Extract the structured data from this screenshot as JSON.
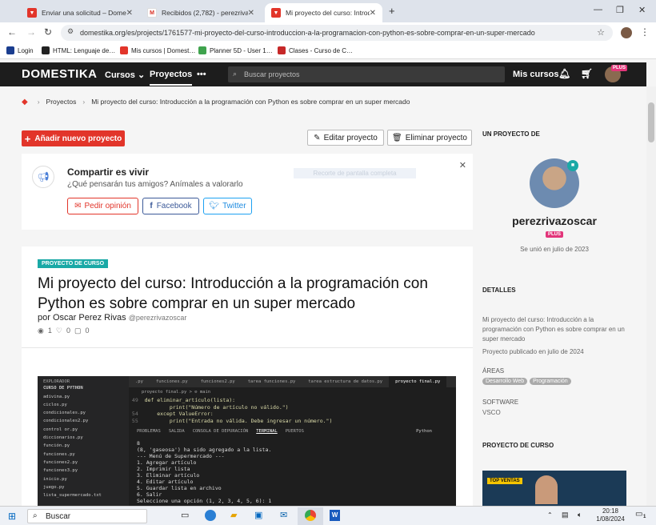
{
  "browser": {
    "tabs": [
      {
        "label": "Enviar una solicitud – Domestika",
        "fav_color": "#e2352a",
        "fav": "M"
      },
      {
        "label": "Recibidos (2,782) - perezrivazo…",
        "fav_color": "#ffffff",
        "fav": "M"
      },
      {
        "label": "Mi proyecto del curso: Introduc…",
        "fav_color": "#e2352a",
        "fav": "M"
      }
    ],
    "new_tab": "+",
    "url": "domestika.org/es/projects/1761577-mi-proyecto-del-curso-introduccion-a-la-programacion-con-python-es-sobre-comprar-en-un-super-mercado",
    "bookmarks": [
      {
        "label": "Login",
        "color": "#1a3d8f"
      },
      {
        "label": "HTML: Lenguaje de…",
        "color": "#222222"
      },
      {
        "label": "Mis cursos | Domest…",
        "color": "#e2352a"
      },
      {
        "label": "Planner 5D - User 1…",
        "color": "#3fa34d"
      },
      {
        "label": "Clases - Curso de C…",
        "color": "#c62828"
      }
    ]
  },
  "site": {
    "logo": "DOMESTIKA",
    "nav": {
      "cursos": "Cursos",
      "proyectos": "Proyectos",
      "more": "•••",
      "mis_cursos": "Mis cursos"
    },
    "search_placeholder": "Buscar proyectos",
    "plus_badge": "PLUS"
  },
  "breadcrumb": {
    "item1": "Proyectos",
    "item2": "Mi proyecto del curso: Introducción a la programación con Python es sobre comprar en un super mercado"
  },
  "actions": {
    "add_project": "Añadir nuevo proyecto",
    "edit": "Editar proyecto",
    "delete": "Eliminar proyecto"
  },
  "share": {
    "title": "Compartir es vivir",
    "subtitle": "¿Qué pensarán tus amigos? Anímales a valorarlo",
    "overlay": "Recorte de pantalla completa",
    "ask": "Pedir opinión",
    "facebook": "Facebook",
    "twitter": "Twitter"
  },
  "project": {
    "badge": "PROYECTO DE CURSO",
    "title_line1": "Mi proyecto del curso: Introducción a la programación con",
    "title_line2": "Python es sobre comprar en un super mercado",
    "author_prefix": "por",
    "author": "Oscar Perez Rivas",
    "handle": "@perezrivazoscar",
    "views": "1",
    "likes": "0",
    "comments": "0"
  },
  "code_screenshot": {
    "explorer_title": "EXPLORADOR",
    "folder": "CURSO DE PYTHON",
    "files": [
      "adivina.py",
      "ciclos.py",
      "condicionales.py",
      "condicionales2.py",
      "control or.py",
      "diccionarios.py",
      "función.py",
      "funciones.py",
      "funciones2.py",
      "funciones3.py",
      "inicio.py",
      "juego.py",
      "lista_supermercado.txt"
    ],
    "tabs": [
      ".py",
      "funciones.py",
      "funciones2.py",
      "tarea funciones.py",
      "tarea estructura de datos.py",
      "proyecto final.py"
    ],
    "breadcrumb": "proyecto final.py > ⊙ main",
    "code_lines": [
      {
        "n": "49",
        "t": "def eliminar_artículo(lista):"
      },
      {
        "n": "",
        "t": "        print(\"Número de artículo no válido.\")"
      },
      {
        "n": "54",
        "t": "    except ValueError:"
      },
      {
        "n": "55",
        "t": "        print(\"Entrada no válida. Debe ingresar un número.\")"
      }
    ],
    "panel_tabs": [
      "PROBLEMAS",
      "SALIDA",
      "CONSOLA DE DEPURACIÓN",
      "TERMINAL",
      "PUERTOS"
    ],
    "panel_right": "Python",
    "terminal": [
      "8",
      "(8, 'gaseosa') ha sido agregado a la lista.",
      "--- Menú de Supermercado ---",
      "1. Agregar artículo",
      "2. Imprimir lista",
      "3. Eliminar artículo",
      "4. Editar artículo",
      "5. Guardar lista en archivo",
      "6. Salir",
      "Seleccione una opción (1, 2, 3, 4, 5, 6): 1"
    ]
  },
  "sidebar": {
    "section_project_of": "UN PROYECTO DE",
    "username": "perezrivazoscar",
    "plus": "PLUS",
    "joined": "Se unió en julio de 2023",
    "details_title": "DETALLES",
    "details_text": "Mi proyecto del curso: Introducción a la programación con Python es sobre comprar en un super mercado",
    "published": "Proyecto publicado en julio de 2024",
    "areas_title": "ÁREAS",
    "areas": [
      "Desarrollo Web",
      "Programación"
    ],
    "software_title": "SOFTWARE",
    "software": "VSCO",
    "course_project_title": "PROYECTO DE CURSO",
    "top_ventas": "TOP VENTAS"
  },
  "taskbar": {
    "search": "Buscar",
    "time": "20:18",
    "date": "1/08/2024",
    "notif": "1"
  }
}
